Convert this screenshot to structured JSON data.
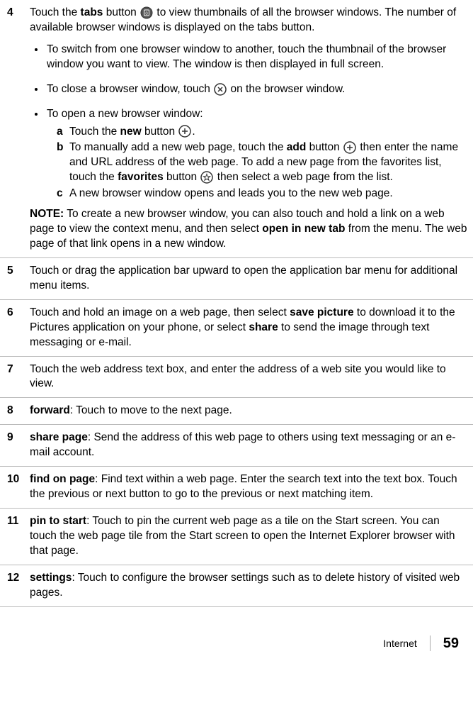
{
  "steps": {
    "s4": {
      "num": "4",
      "p1_a": "Touch the ",
      "p1_b": "tabs",
      "p1_c": " button ",
      "p1_d": " to view thumbnails of all the browser windows. The number of available browser windows is displayed on the tabs button.",
      "b1": "To switch from one browser window to another, touch the thumbnail of the browser window you want to view. The window is then displayed in full screen.",
      "b2_a": "To close a browser window, touch ",
      "b2_b": " on the browser window.",
      "b3": "To open a new browser window:",
      "sa_l": "a",
      "sa_1": "Touch the ",
      "sa_2": "new",
      "sa_3": " button ",
      "sa_4": ".",
      "sb_l": "b",
      "sb_1": "To manually add a new web page, touch the ",
      "sb_2": "add",
      "sb_3": " button ",
      "sb_4": " then enter the name and URL address of the web page. To add a new page from the favorites list, touch the ",
      "sb_5": "favorites",
      "sb_6": " button ",
      "sb_7": " then select a web page from the list.",
      "sc_l": "c",
      "sc": "A new browser window opens and leads you to the new web page.",
      "note_label": "NOTE:",
      "note_1": " To create a new browser window, you can also touch and hold a link on a web page to view the context menu, and then select ",
      "note_2": "open in new tab",
      "note_3": " from the menu. The web page of that link opens in a new window."
    },
    "s5": {
      "num": "5",
      "text": "Touch or drag the application bar upward to open the application bar menu for additional menu items."
    },
    "s6": {
      "num": "6",
      "t1": "Touch and hold an image on a web page, then select ",
      "t2": "save picture",
      "t3": " to download it to the Pictures application on your phone, or select ",
      "t4": "share",
      "t5": " to send the image through text messaging or e-mail."
    },
    "s7": {
      "num": "7",
      "text": "Touch the web address text box, and enter the address of a web site you would like to view."
    },
    "s8": {
      "num": "8",
      "t1": "forward",
      "t2": ": Touch to move to the next page."
    },
    "s9": {
      "num": "9",
      "t1": "share page",
      "t2": ": Send the address of this web page to others using text messaging or an e-mail account."
    },
    "s10": {
      "num": "10",
      "t1": "find on page",
      "t2": ": Find text within a web page. Enter the search text into the text box. Touch the previous or next button to go to the previous or next matching item."
    },
    "s11": {
      "num": "11",
      "t1": "pin to start",
      "t2": ": Touch to pin the current web page as a tile on the Start screen. You can touch the web page tile from the Start screen to open the Internet Explorer browser with that page."
    },
    "s12": {
      "num": "12",
      "t1": "settings",
      "t2": ": Touch to configure the browser settings such as to delete history of visited web pages."
    }
  },
  "footer": {
    "section": "Internet",
    "page": "59"
  }
}
